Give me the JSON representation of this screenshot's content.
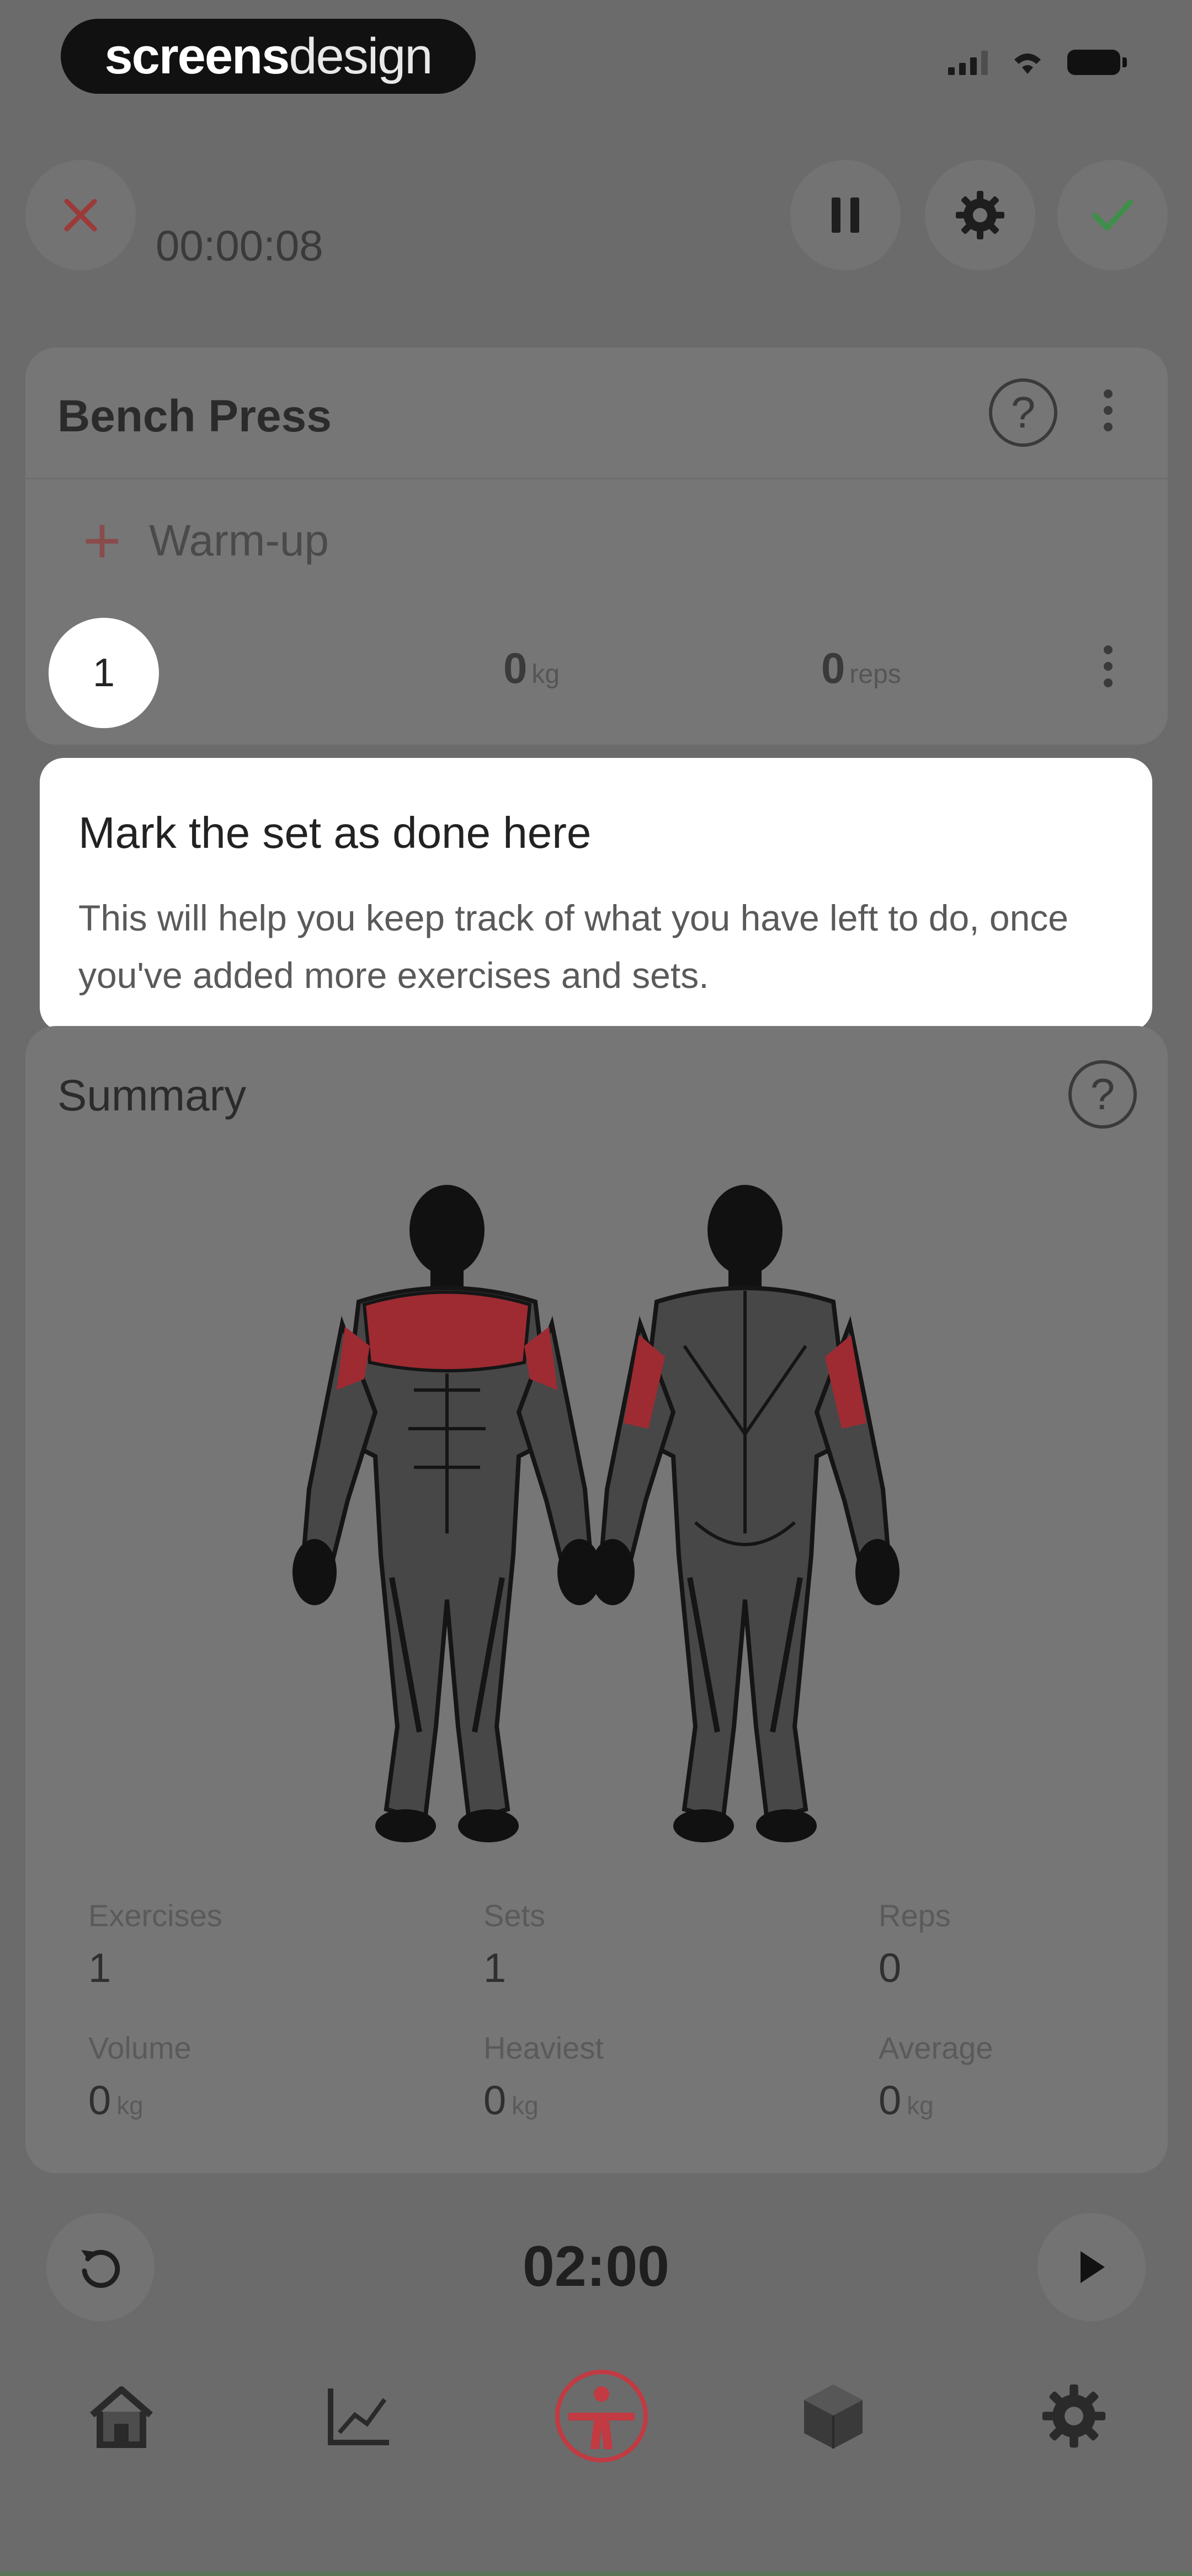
{
  "status_bar": {
    "brand_bold": "screens",
    "brand_light": "design"
  },
  "toolbar": {
    "elapsed": "00:00:08",
    "close_icon": "close-icon",
    "pause_icon": "pause-icon",
    "settings_icon": "gear-icon",
    "finish_icon": "check-icon"
  },
  "exercise": {
    "title": "Bench Press",
    "warmup_label": "Warm-up",
    "sets": [
      {
        "number": "1",
        "weight": "0",
        "weight_unit": "kg",
        "reps": "0",
        "reps_unit": "reps"
      }
    ]
  },
  "tooltip": {
    "title": "Mark the set as done here",
    "body": "This will help you keep track of what you have left to do, once you've added more exercises and sets."
  },
  "summary": {
    "title": "Summary",
    "stats": [
      {
        "label": "Exercises",
        "value": "1",
        "unit": ""
      },
      {
        "label": "Sets",
        "value": "1",
        "unit": ""
      },
      {
        "label": "Reps",
        "value": "0",
        "unit": ""
      },
      {
        "label": "Volume",
        "value": "0",
        "unit": "kg"
      },
      {
        "label": "Heaviest",
        "value": "0",
        "unit": "kg"
      },
      {
        "label": "Average",
        "value": "0",
        "unit": "kg"
      }
    ],
    "muscle_highlight_color": "#9e2b32"
  },
  "rest_timer": {
    "time": "02:00"
  },
  "nav": {
    "items": [
      "home-icon",
      "chart-icon",
      "workout-icon",
      "cube-icon",
      "settings-icon"
    ],
    "active_index": 2,
    "accent": "#c23a42"
  },
  "colors": {
    "close": "#9c3a3a",
    "check": "#3f8f4a",
    "overlay": "#6b6b6b"
  }
}
